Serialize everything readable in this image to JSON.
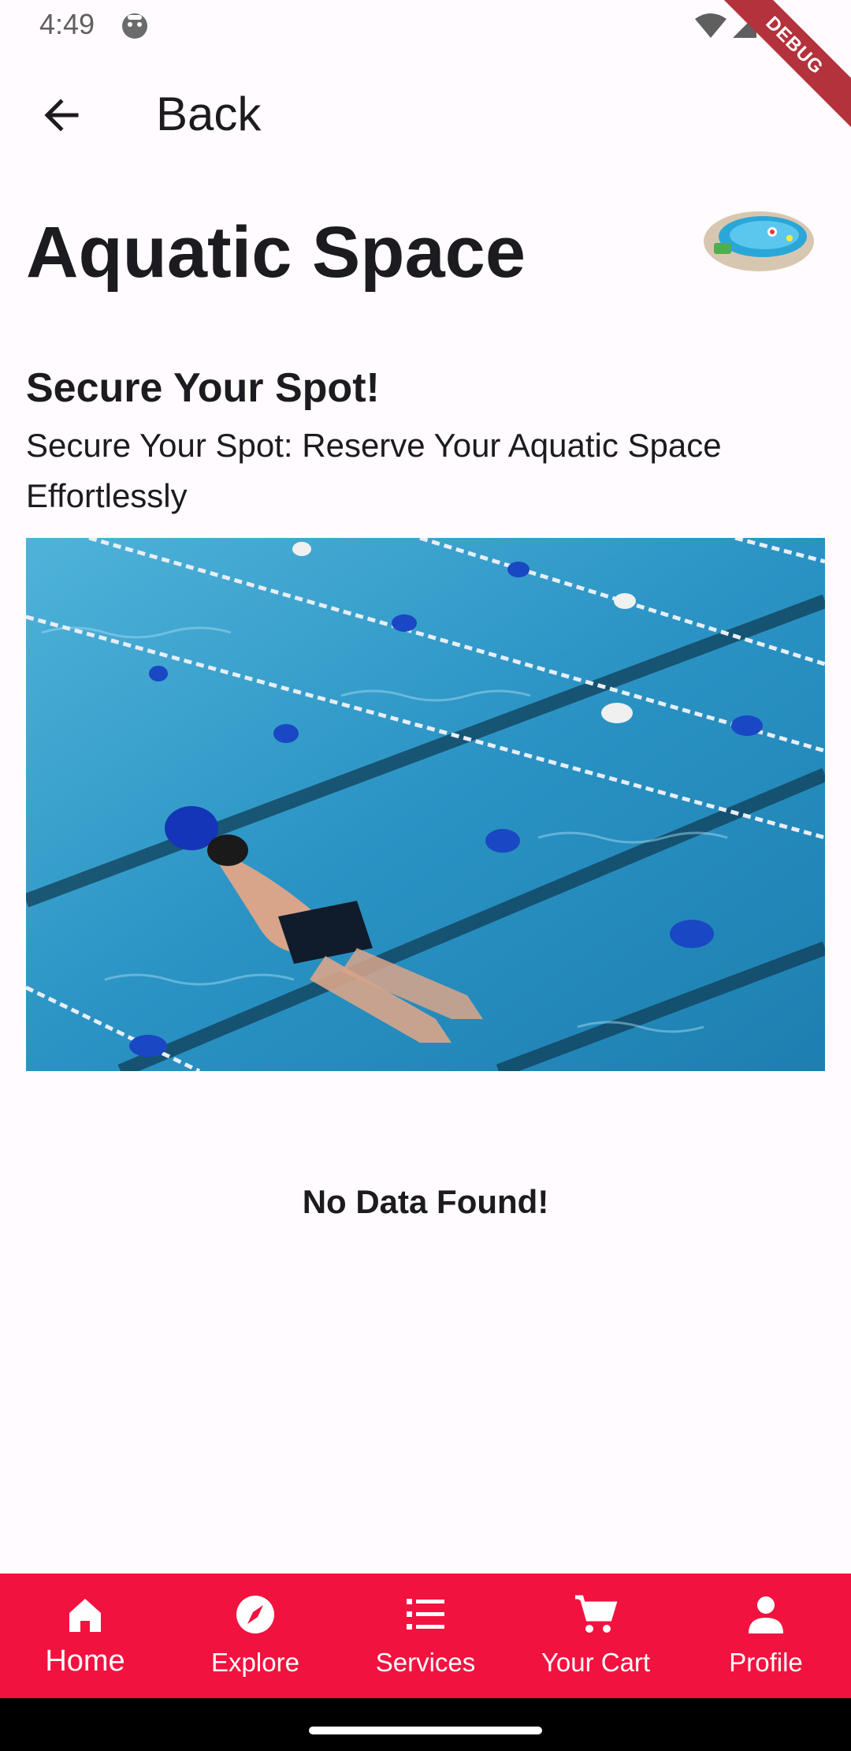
{
  "status": {
    "time": "4:49",
    "debug_label": "DEBUG"
  },
  "app_bar": {
    "back_label": "Back"
  },
  "page": {
    "title": "Aquatic Space",
    "section_heading": "Secure Your Spot!",
    "section_description": "Secure Your Spot: Reserve Your Aquatic Space Effortlessly",
    "empty_message": "No Data Found!"
  },
  "bottom_nav": {
    "items": [
      {
        "label": "Home",
        "icon": "home-icon",
        "active": true
      },
      {
        "label": "Explore",
        "icon": "compass-icon",
        "active": false
      },
      {
        "label": "Services",
        "icon": "list-icon",
        "active": false
      },
      {
        "label": "Your Cart",
        "icon": "cart-icon",
        "active": false
      },
      {
        "label": "Profile",
        "icon": "person-icon",
        "active": false
      }
    ]
  },
  "colors": {
    "accent": "#f2123f",
    "background": "#fffbfe",
    "text": "#1c1b1f"
  }
}
